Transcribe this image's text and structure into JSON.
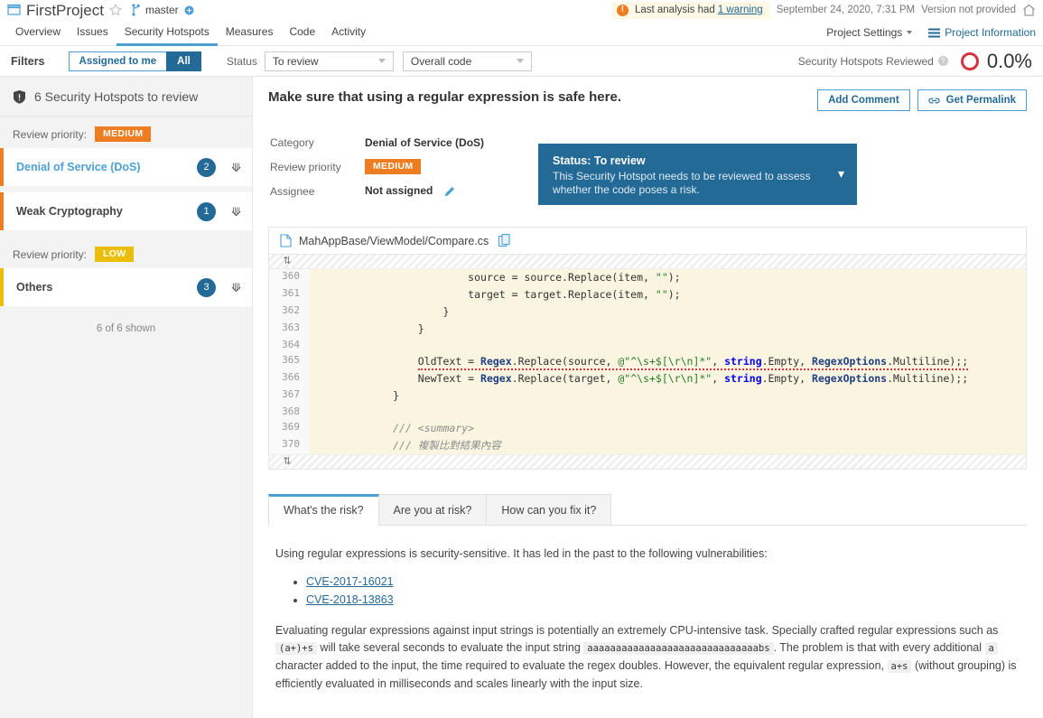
{
  "topbar": {
    "project_name": "FirstProject",
    "branch": "master",
    "warning_prefix": "Last analysis had",
    "warning_link": "1 warning",
    "analysis_date": "September 24, 2020, 7:31 PM",
    "version": "Version not provided",
    "icons": {
      "project": "project-icon",
      "star": "star-icon",
      "branch": "branch-icon",
      "branch_status": "branch-status-icon",
      "home": "home-icon"
    }
  },
  "nav": {
    "items": [
      {
        "label": "Overview",
        "active": false
      },
      {
        "label": "Issues",
        "active": false
      },
      {
        "label": "Security Hotspots",
        "active": true
      },
      {
        "label": "Measures",
        "active": false
      },
      {
        "label": "Code",
        "active": false
      },
      {
        "label": "Activity",
        "active": false
      }
    ],
    "project_settings": "Project Settings",
    "project_information": "Project Information"
  },
  "filters": {
    "label": "Filters",
    "assigned_to_me": "Assigned to me",
    "all": "All",
    "all_selected": true,
    "status_label": "Status",
    "status_value": "To review",
    "scope_value": "Overall code",
    "reviewed_label": "Security Hotspots Reviewed",
    "reviewed_pct": "0.0%",
    "reviewed_color": "#d4333f"
  },
  "sidebar": {
    "heading": "6 Security Hotspots to review",
    "priority_groups": [
      {
        "priority_label": "Review priority:",
        "priority": "MEDIUM",
        "priority_color": "#ed7d20",
        "items": [
          {
            "name": "Denial of Service (DoS)",
            "count": "2",
            "active": true
          },
          {
            "name": "Weak Cryptography",
            "count": "1",
            "active": false
          }
        ]
      },
      {
        "priority_label": "Review priority:",
        "priority": "LOW",
        "priority_color": "#eabe06",
        "items": [
          {
            "name": "Others",
            "count": "3",
            "active": false
          }
        ]
      }
    ],
    "shown_note": "6 of 6 shown"
  },
  "hotspot": {
    "title": "Make sure that using a regular expression is safe here.",
    "add_comment": "Add Comment",
    "get_permalink": "Get Permalink",
    "meta": {
      "category_key": "Category",
      "category_value": "Denial of Service (DoS)",
      "priority_key": "Review priority",
      "priority_value": "MEDIUM",
      "assignee_key": "Assignee",
      "assignee_value": "Not assigned"
    },
    "status_card": {
      "title": "Status: To review",
      "description": "This Security Hotspot needs to be reviewed to assess whether the code poses a risk."
    }
  },
  "code": {
    "file_path": "MahAppBase/ViewModel/Compare.cs",
    "lines": [
      {
        "num": "360",
        "indent": 24,
        "parts": [
          {
            "t": "source = source.Replace(item, ",
            "c": ""
          },
          {
            "t": "\"\"",
            "c": "k-str"
          },
          {
            "t": ");",
            "c": ""
          }
        ]
      },
      {
        "num": "361",
        "indent": 24,
        "parts": [
          {
            "t": "target = target.Replace(item, ",
            "c": ""
          },
          {
            "t": "\"\"",
            "c": "k-str"
          },
          {
            "t": ");",
            "c": ""
          }
        ]
      },
      {
        "num": "362",
        "indent": 20,
        "parts": [
          {
            "t": "}",
            "c": ""
          }
        ]
      },
      {
        "num": "363",
        "indent": 16,
        "parts": [
          {
            "t": "}",
            "c": ""
          }
        ]
      },
      {
        "num": "364",
        "indent": 0,
        "parts": []
      },
      {
        "num": "365",
        "indent": 16,
        "issue": true,
        "parts": [
          {
            "t": "OldText = ",
            "c": ""
          },
          {
            "t": "Regex",
            "c": "k-type"
          },
          {
            "t": ".Replace(source, ",
            "c": ""
          },
          {
            "t": "@\"^\\s+$[\\r\\n]*\"",
            "c": "k-str"
          },
          {
            "t": ", ",
            "c": ""
          },
          {
            "t": "string",
            "c": "k-blue"
          },
          {
            "t": ".Empty, ",
            "c": ""
          },
          {
            "t": "RegexOptions",
            "c": "k-type"
          },
          {
            "t": ".Multiline);;",
            "c": ""
          }
        ]
      },
      {
        "num": "366",
        "indent": 16,
        "parts": [
          {
            "t": "NewText = ",
            "c": ""
          },
          {
            "t": "Regex",
            "c": "k-type"
          },
          {
            "t": ".Replace(target, ",
            "c": ""
          },
          {
            "t": "@\"^\\s+$[\\r\\n]*\"",
            "c": "k-str"
          },
          {
            "t": ", ",
            "c": ""
          },
          {
            "t": "string",
            "c": "k-blue"
          },
          {
            "t": ".Empty, ",
            "c": ""
          },
          {
            "t": "RegexOptions",
            "c": "k-type"
          },
          {
            "t": ".Multiline);;",
            "c": ""
          }
        ]
      },
      {
        "num": "367",
        "indent": 12,
        "parts": [
          {
            "t": "}",
            "c": ""
          }
        ]
      },
      {
        "num": "368",
        "indent": 0,
        "parts": []
      },
      {
        "num": "369",
        "indent": 12,
        "parts": [
          {
            "t": "/// <summary>",
            "c": "k-cmt"
          }
        ]
      },
      {
        "num": "370",
        "indent": 12,
        "parts": [
          {
            "t": "/// 複製比對結果內容",
            "c": "k-cmt"
          }
        ]
      }
    ]
  },
  "tabs": [
    {
      "label": "What's the risk?",
      "active": true
    },
    {
      "label": "Are you at risk?",
      "active": false
    },
    {
      "label": "How can you fix it?",
      "active": false
    }
  ],
  "risk_content": {
    "intro": "Using regular expressions is security-sensitive. It has led in the past to the following vulnerabilities:",
    "cve_list": [
      "CVE-2017-16021",
      "CVE-2018-13863"
    ],
    "para2_a": "Evaluating regular expressions against input strings is potentially an extremely CPU-intensive task. Specially crafted regular expressions such as",
    "code1": "(a+)+s",
    "para2_b": "will take several seconds to evaluate the input string",
    "code2": "aaaaaaaaaaaaaaaaaaaaaaaaaaaaaabs",
    "para2_c": ". The problem is that with every additional",
    "code3": "a",
    "para2_d": "character added to the input, the time required to evaluate the regex doubles. However, the equivalent regular expression,",
    "code4": "a+s",
    "para2_e": "(without grouping) is efficiently evaluated in milliseconds and scales linearly with the input size."
  }
}
